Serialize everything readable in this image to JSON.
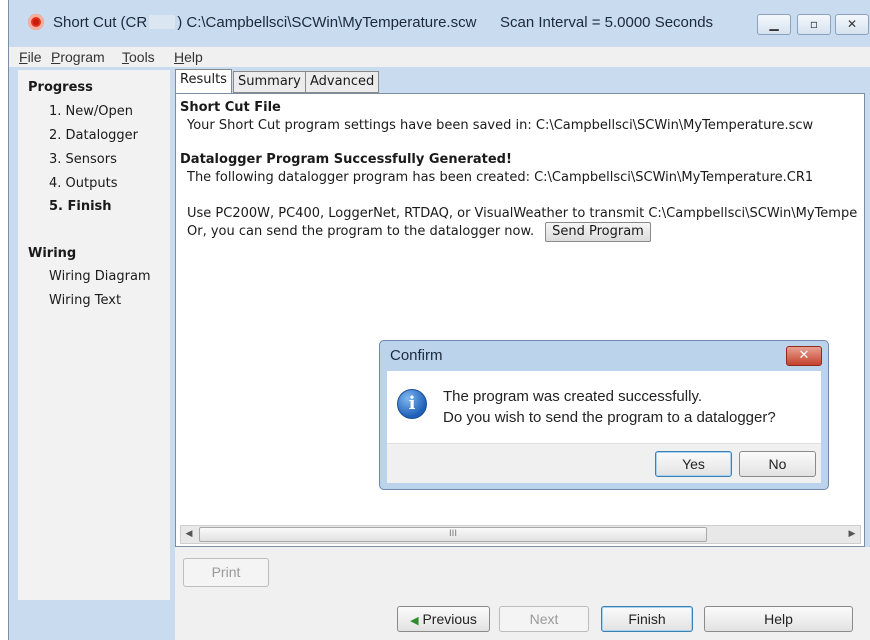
{
  "window": {
    "title_prefix": "Short Cut (CR",
    "title_path": ") C:\\Campbellsci\\SCWin\\MyTemperature.scw",
    "scan_interval": "Scan Interval = 5.0000 Seconds",
    "minimize_glyph": "▁",
    "maximize_glyph": "▫",
    "close_glyph": "✕"
  },
  "menu": [
    "File",
    "Program",
    "Tools",
    "Help"
  ],
  "sidebar": {
    "progress_heading": "Progress",
    "progress_items": [
      "1. New/Open",
      "2. Datalogger",
      "3. Sensors",
      "4. Outputs",
      "5. Finish"
    ],
    "active_item": "5. Finish",
    "wiring_heading": "Wiring",
    "wiring_items": [
      "Wiring Diagram",
      "Wiring Text"
    ]
  },
  "tabs": [
    {
      "label": "Results",
      "active": true
    },
    {
      "label": "Summary",
      "active": false
    },
    {
      "label": "Advanced",
      "active": false
    }
  ],
  "results": {
    "file_heading": "Short Cut File",
    "file_line": "Your Short Cut program settings have been saved in: C:\\Campbellsci\\SCWin\\MyTemperature.scw",
    "program_heading": "Datalogger Program Successfully Generated!",
    "program_line": "The following datalogger program has been created: C:\\Campbellsci\\SCWin\\MyTemperature.CR1",
    "transmit_line": "Use PC200W, PC400, LoggerNet, RTDAQ, or VisualWeather to transmit C:\\Campbellsci\\SCWin\\MyTempe",
    "send_line": "Or, you can send the program to the datalogger now.",
    "send_button": "Send Program"
  },
  "scrollbar": {
    "thumb_grip": "III",
    "left_arrow": "◀",
    "right_arrow": "▶"
  },
  "bottom": {
    "print": "Print",
    "previous": "Previous",
    "next": "Next",
    "finish": "Finish",
    "help": "Help"
  },
  "dialog": {
    "title": "Confirm",
    "close": "✕",
    "icon_glyph": "i",
    "line1": "The program was created successfully.",
    "line2": "Do you wish to send the program to a datalogger?",
    "yes": "Yes",
    "no": "No"
  },
  "colors": {
    "accent": "#3c7fb1",
    "window_frame": "#c9dbee",
    "close_red": "#c4412c",
    "info_blue": "#1f5fb8"
  }
}
